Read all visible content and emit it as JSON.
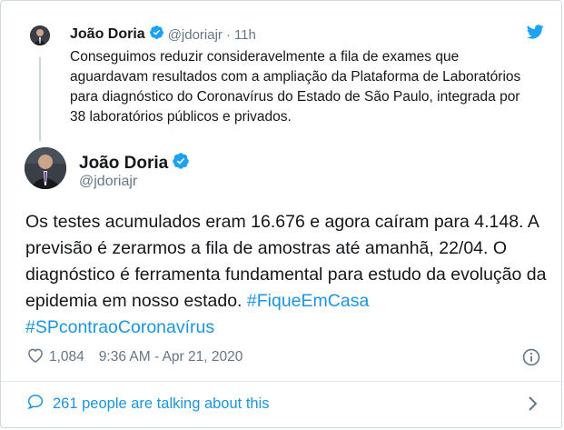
{
  "parent_tweet": {
    "name": "João Doria",
    "handle": "@jdoriajr",
    "separator": "·",
    "time": "11h",
    "text": "Conseguimos reduzir consideravelmente a fila de exames que aguardavam resultados com a ampliação da Plataforma de Laboratórios para diagnóstico do Coronavírus do Estado de São Paulo, integrada por 38 laboratórios públicos e privados."
  },
  "main_tweet": {
    "name": "João Doria",
    "handle": "@jdoriajr",
    "text": "Os testes acumulados eram 16.676 e agora caíram para 4.148. A previsão é zerarmos a fila de amostras até amanhã, 22/04. O diagnóstico é ferramenta fundamental para estudo da evolução da epidemia em nosso estado. ",
    "hashtags": [
      "#FiqueEmCasa",
      "#SPcontraoCoronavírus"
    ],
    "likes": "1,084",
    "timestamp": "9:36 AM - Apr 21, 2020"
  },
  "footer": {
    "talking": "261 people are talking about this"
  },
  "colors": {
    "accent": "#1b95e0",
    "verified": "#1da1f2",
    "muted": "#657786",
    "text": "#14171a"
  },
  "icons": [
    "twitter-bird-icon",
    "verified-badge-icon",
    "heart-icon",
    "info-icon",
    "speech-bubble-icon",
    "chevron-right-icon"
  ]
}
